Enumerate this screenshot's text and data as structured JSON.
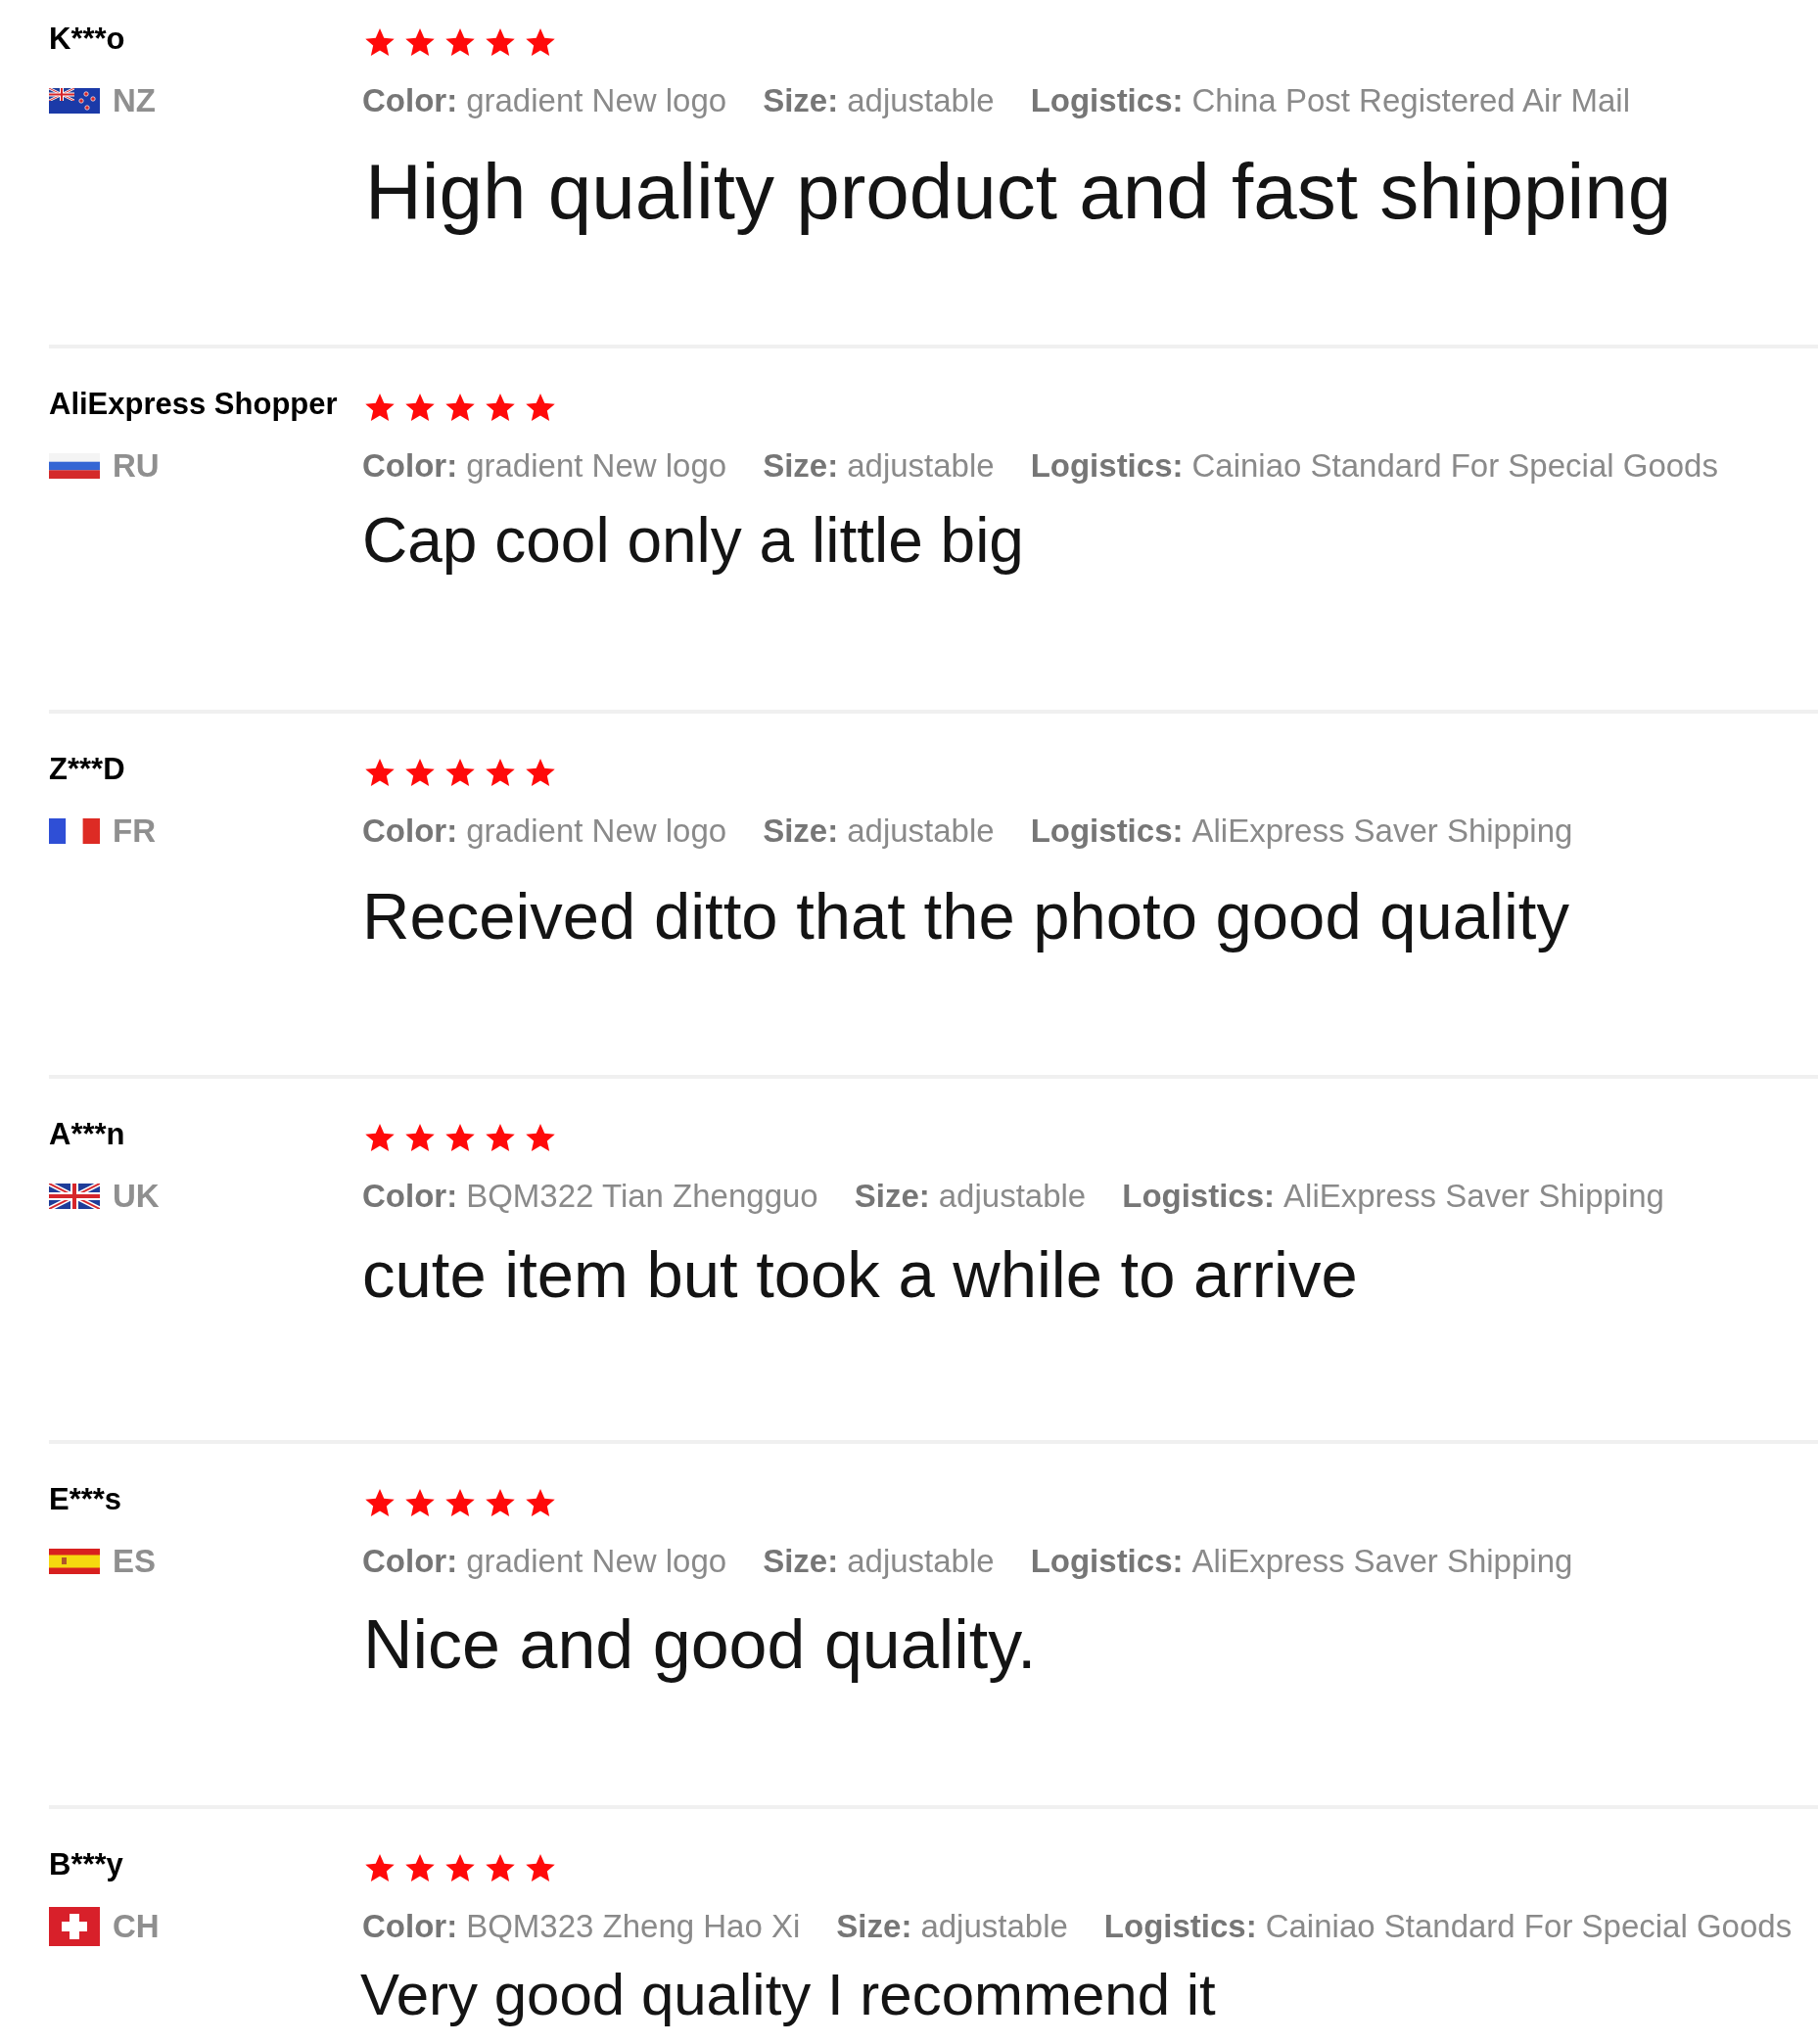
{
  "reviews": [
    {
      "name": "K***o",
      "flag": {
        "kind": "new_zealand"
      },
      "country": "NZ",
      "stars": 5,
      "attributes": [
        {
          "label": "Color:",
          "value": "gradient New logo"
        },
        {
          "label": "Size:",
          "value": "adjustable"
        },
        {
          "label": "Logistics:",
          "value": "China Post Registered Air Mail"
        }
      ],
      "text": "High quality product and fast shipping"
    },
    {
      "name": "AliExpress Shopper",
      "flag": {
        "kind": "russia"
      },
      "country": "RU",
      "stars": 5,
      "attributes": [
        {
          "label": "Color:",
          "value": "gradient New logo"
        },
        {
          "label": "Size:",
          "value": "adjustable"
        },
        {
          "label": "Logistics:",
          "value": "Cainiao Standard For Special Goods"
        }
      ],
      "text": "Cap cool only a little big"
    },
    {
      "name": "Z***D",
      "flag": {
        "kind": "france"
      },
      "country": "FR",
      "stars": 5,
      "attributes": [
        {
          "label": "Color:",
          "value": "gradient New logo"
        },
        {
          "label": "Size:",
          "value": "adjustable"
        },
        {
          "label": "Logistics:",
          "value": "AliExpress Saver Shipping"
        }
      ],
      "text": "Received ditto that the photo good quality"
    },
    {
      "name": "A***n",
      "flag": {
        "kind": "united_kingdom"
      },
      "country": "UK",
      "stars": 5,
      "attributes": [
        {
          "label": "Color:",
          "value": "BQM322 Tian Zhengguo"
        },
        {
          "label": "Size:",
          "value": "adjustable"
        },
        {
          "label": "Logistics:",
          "value": "AliExpress Saver Shipping"
        }
      ],
      "text": "cute item but took a while to arrive"
    },
    {
      "name": "E***s",
      "flag": {
        "kind": "spain"
      },
      "country": "ES",
      "stars": 5,
      "attributes": [
        {
          "label": "Color:",
          "value": "gradient New logo"
        },
        {
          "label": "Size:",
          "value": "adjustable"
        },
        {
          "label": "Logistics:",
          "value": "AliExpress Saver Shipping"
        }
      ],
      "text": "Nice and good quality."
    },
    {
      "name": "B***y",
      "flag": {
        "kind": "switzerland"
      },
      "country": "CH",
      "stars": 5,
      "attributes": [
        {
          "label": "Color:",
          "value": "BQM323 Zheng Hao Xi"
        },
        {
          "label": "Size:",
          "value": "adjustable"
        },
        {
          "label": "Logistics:",
          "value": "Cainiao Standard For Special Goods"
        }
      ],
      "text": "Very good quality I recommend it"
    }
  ]
}
